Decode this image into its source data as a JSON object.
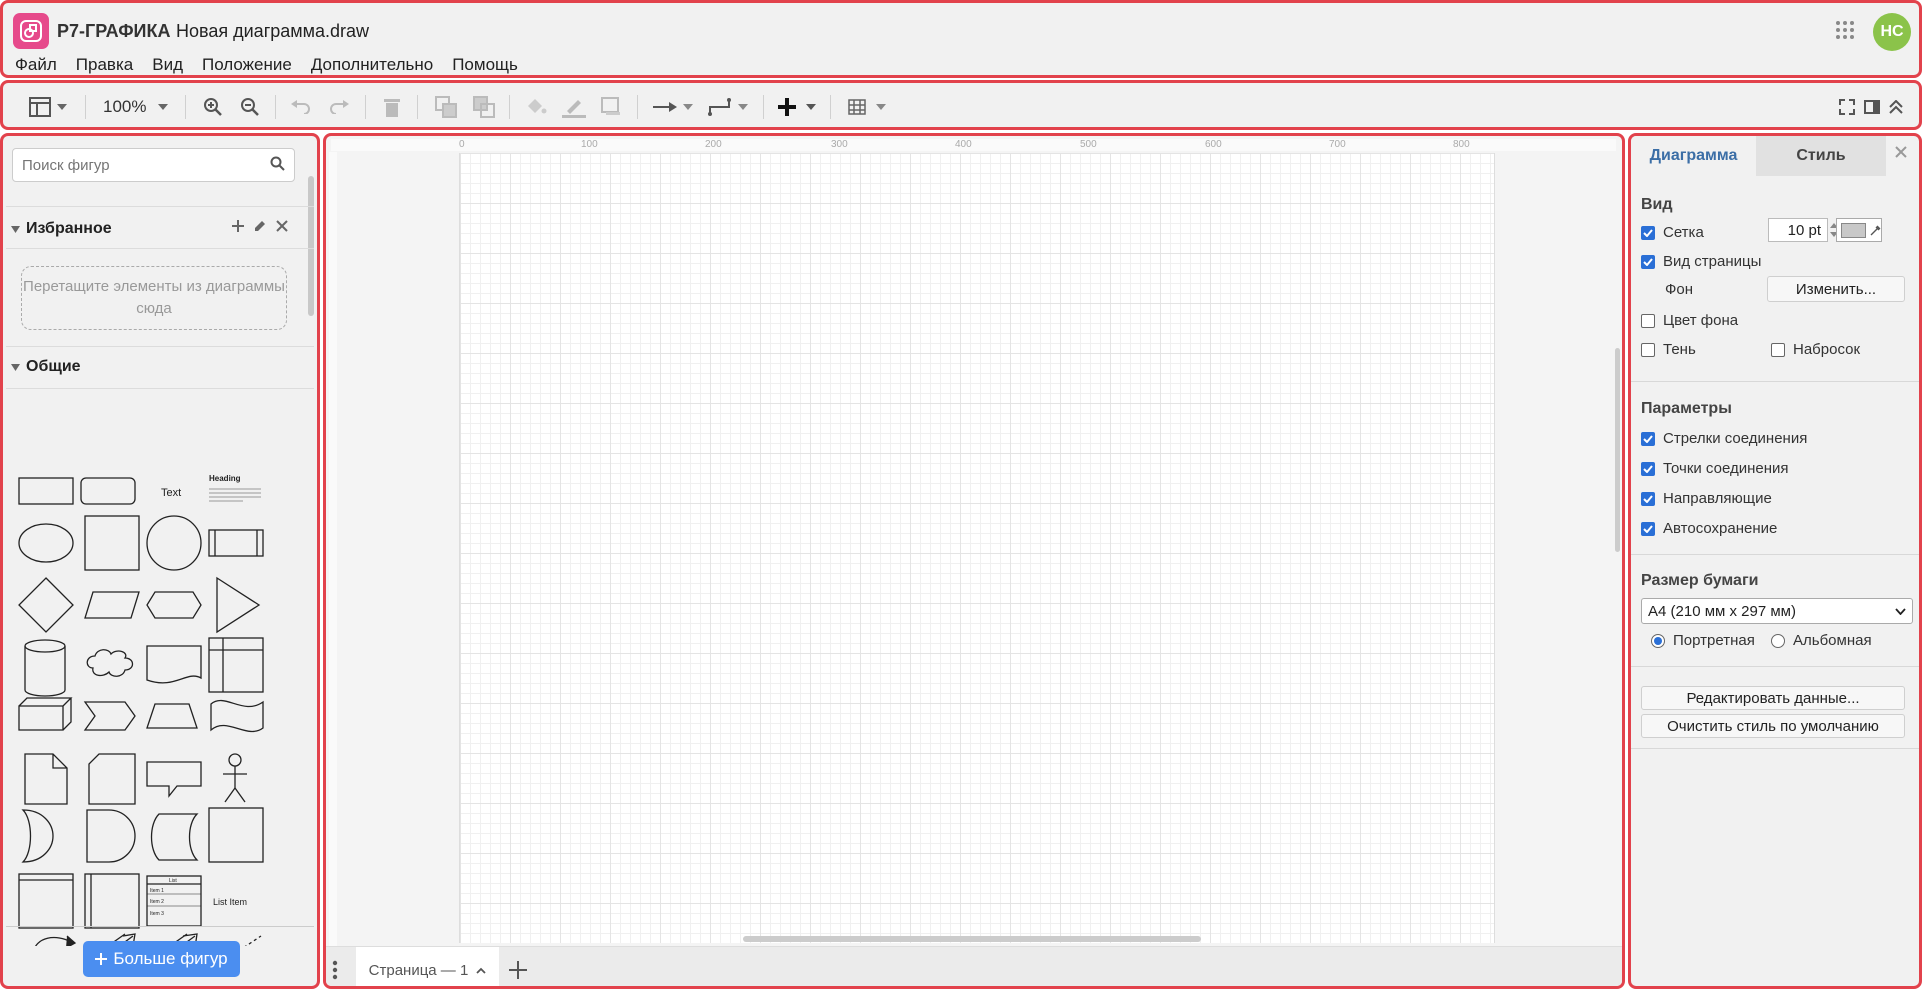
{
  "header": {
    "app_name": "Р7-ГРАФИКА",
    "doc_name": "Новая диаграмма.draw",
    "avatar_initials": "НС",
    "menu": [
      "Файл",
      "Правка",
      "Вид",
      "Положение",
      "Дополнительно",
      "Помощь"
    ]
  },
  "toolbar": {
    "zoom": "100%"
  },
  "left": {
    "search_placeholder": "Поиск фигур",
    "favorites_title": "Избранное",
    "dropzone_text": "Перетащите элементы из диаграммы сюда",
    "general_title": "Общие",
    "shape_text": "Text",
    "shape_heading": "Heading",
    "shape_list": "List",
    "shape_list_item": "List Item",
    "shape_item1": "Item 1",
    "shape_item2": "Item 2",
    "shape_item3": "Item 3",
    "more_shapes": "Больше фигур"
  },
  "canvas": {
    "ruler_labels": [
      "0",
      "100",
      "200",
      "300",
      "400",
      "500",
      "600",
      "700",
      "800"
    ],
    "page_tab": "Страница — 1"
  },
  "right": {
    "tab_diagram": "Диаграмма",
    "tab_style": "Стиль",
    "view_title": "Вид",
    "grid_label": "Сетка",
    "grid_size": "10 pt",
    "page_view_label": "Вид страницы",
    "background_label": "Фон",
    "change_button": "Изменить...",
    "bg_color_label": "Цвет фона",
    "shadow_label": "Тень",
    "sketch_label": "Набросок",
    "params_title": "Параметры",
    "conn_arrows": "Стрелки соединения",
    "conn_points": "Точки соединения",
    "guides": "Направляющие",
    "autosave": "Автосохранение",
    "paper_title": "Размер бумаги",
    "paper_size": "A4 (210 мм x 297 мм)",
    "portrait": "Портретная",
    "landscape": "Альбомная",
    "edit_data": "Редактировать данные...",
    "clear_style": "Очистить стиль по умолчанию"
  }
}
